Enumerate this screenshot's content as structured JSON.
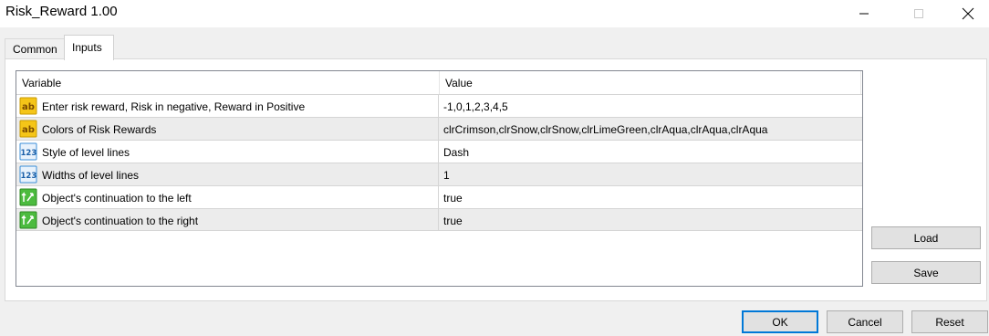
{
  "window": {
    "title": "Risk_Reward 1.00"
  },
  "tabs": [
    {
      "label": "Common",
      "active": false
    },
    {
      "label": "Inputs",
      "active": true
    }
  ],
  "grid": {
    "columns": {
      "variable": "Variable",
      "value": "Value"
    },
    "rows": [
      {
        "icon": "ab-string-icon",
        "variable": "Enter risk reward, Risk in negative, Reward in Positive",
        "value": "-1,0,1,2,3,4,5"
      },
      {
        "icon": "ab-string-icon",
        "variable": "Colors of Risk Rewards",
        "value": "clrCrimson,clrSnow,clrSnow,clrLimeGreen,clrAqua,clrAqua,clrAqua"
      },
      {
        "icon": "123-number-icon",
        "variable": "Style of level lines",
        "value": "Dash"
      },
      {
        "icon": "123-number-icon",
        "variable": "Widths of level lines",
        "value": "1"
      },
      {
        "icon": "bool-arrow-icon",
        "variable": "Object's continuation to the left",
        "value": "true"
      },
      {
        "icon": "bool-arrow-icon",
        "variable": "Object's continuation to the right",
        "value": "true"
      }
    ]
  },
  "buttons": {
    "load": "Load",
    "save": "Save",
    "ok": "OK",
    "cancel": "Cancel",
    "reset": "Reset"
  },
  "colors": {
    "accent": "#0078d7",
    "alt_row": "#ececec",
    "string_icon": "#f2b600",
    "number_icon": "#3b8fd8",
    "bool_icon": "#3aa52f"
  }
}
